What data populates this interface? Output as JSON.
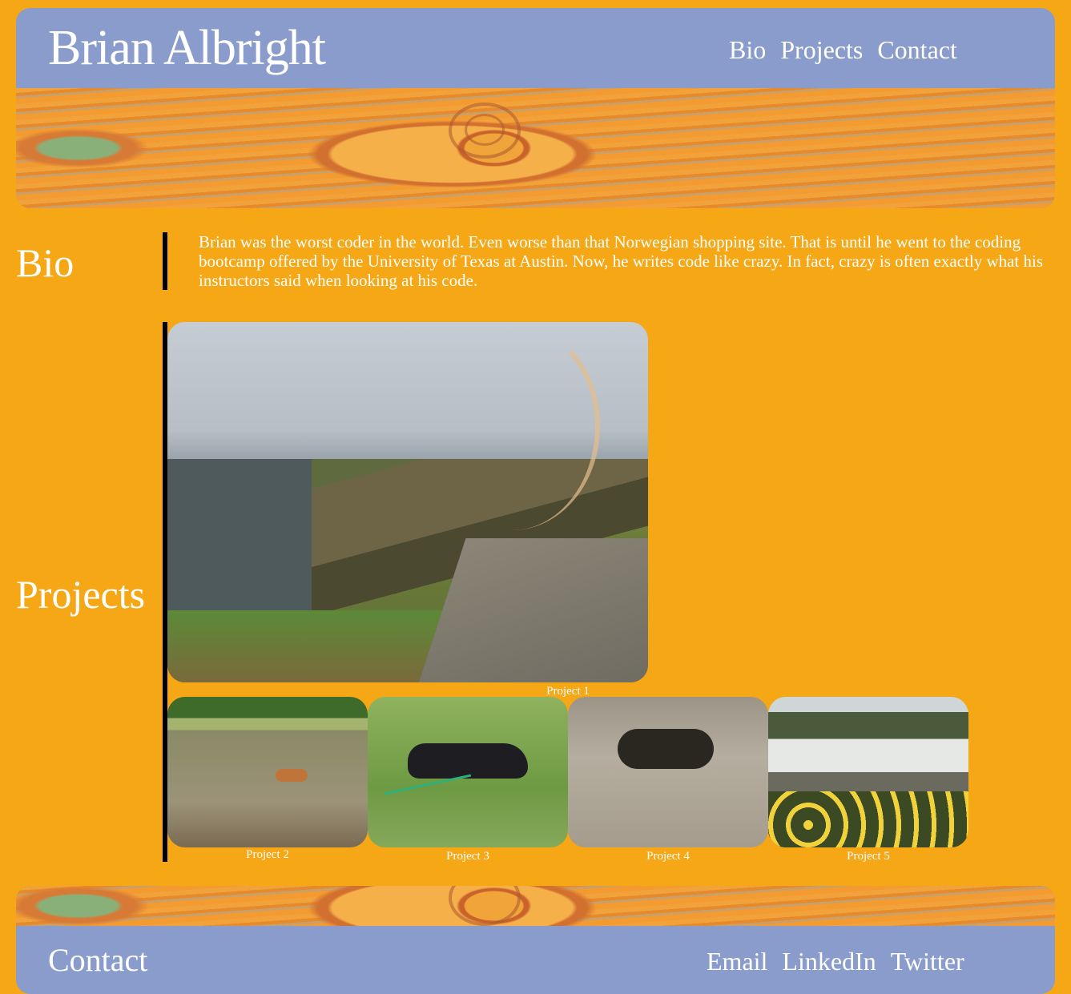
{
  "header": {
    "title": "Brian Albright",
    "nav": [
      "Bio",
      "Projects",
      "Contact"
    ]
  },
  "bio": {
    "heading": "Bio",
    "text": "Brian was the worst coder in the world. Even worse than that Norwegian shopping site. That is until he went to the coding bootcamp offered by the University of Texas at Austin. Now, he writes code like crazy. In fact, crazy is often exactly what his instructors said when looking at his code."
  },
  "projects": {
    "heading": "Projects",
    "items": [
      {
        "caption": "Project 1"
      },
      {
        "caption": "Project 2"
      },
      {
        "caption": "Project 3"
      },
      {
        "caption": "Project 4"
      },
      {
        "caption": "Project 5"
      }
    ]
  },
  "footer": {
    "title": "Contact",
    "links": [
      "Email",
      "LinkedIn",
      "Twitter"
    ]
  },
  "colors": {
    "background": "#f5a716",
    "bar": "#8a9ccb",
    "text": "#ffffff",
    "divider": "#000000"
  }
}
